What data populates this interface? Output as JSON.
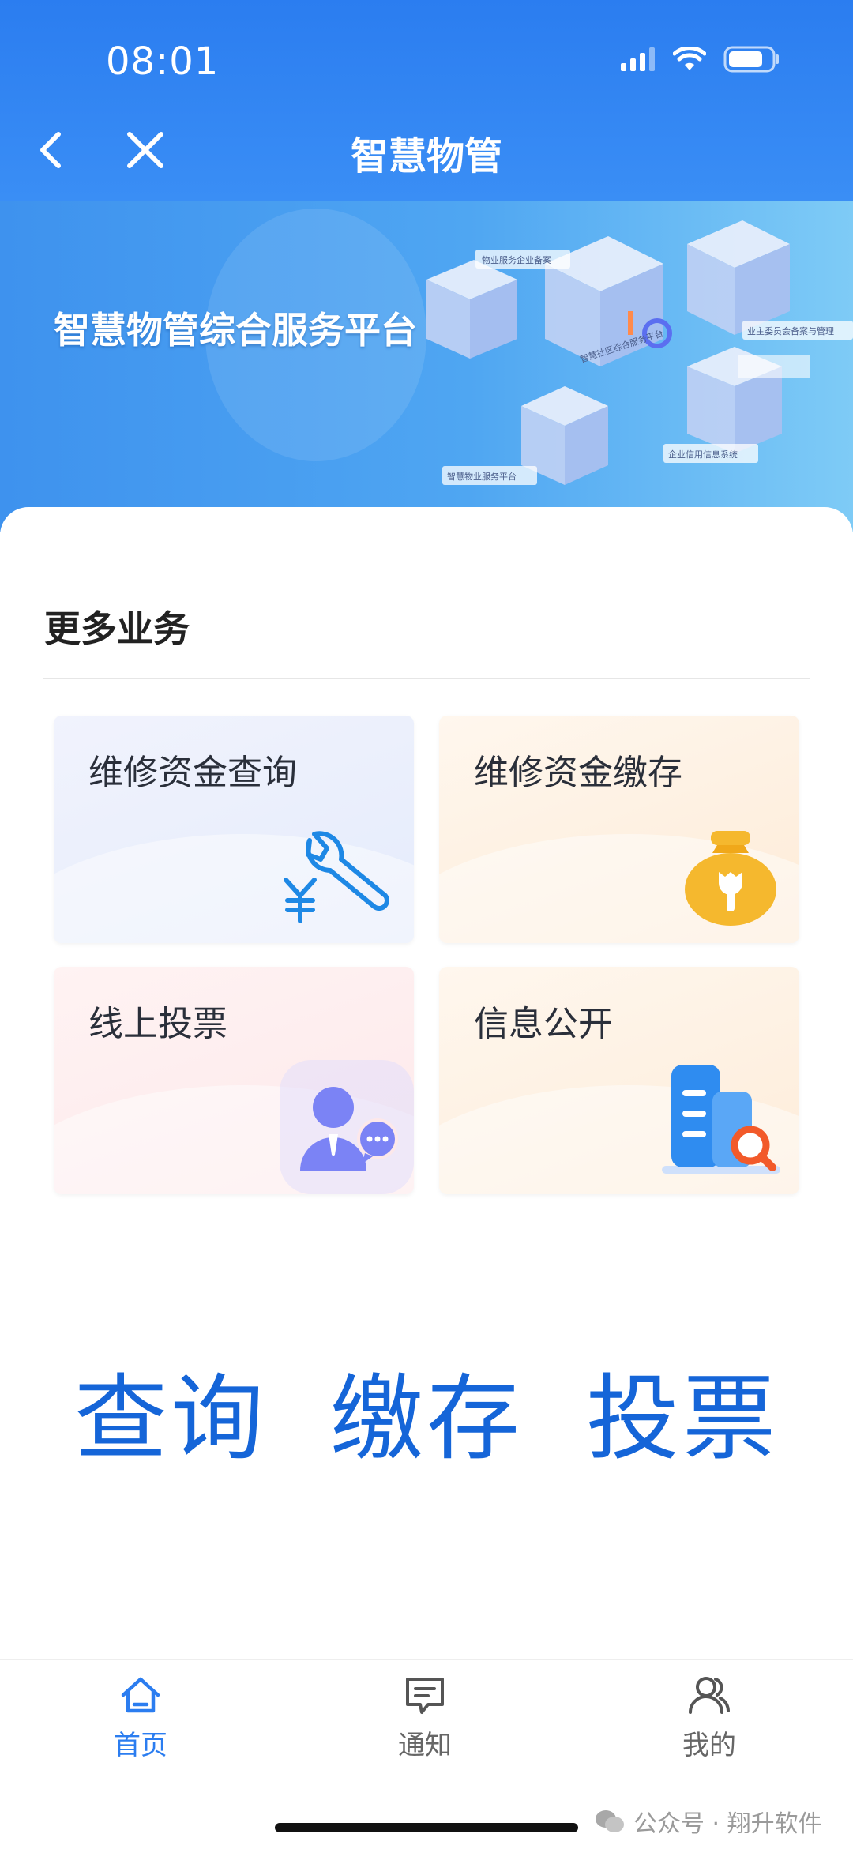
{
  "status_bar": {
    "time": "08:01"
  },
  "nav": {
    "title": "智慧物管"
  },
  "banner": {
    "title": "智慧物管综合服务平台",
    "art_labels": [
      "物业服务企业备案",
      "业主委员会备案与管理",
      "智慧社区综合服务平台",
      "企业信用信息系统",
      "智慧物业服务平台"
    ]
  },
  "section": {
    "title": "更多业务"
  },
  "cards": [
    {
      "label": "维修资金查询",
      "icon": "wrench-yen-icon"
    },
    {
      "label": "维修资金缴存",
      "icon": "money-bag-icon"
    },
    {
      "label": "线上投票",
      "icon": "person-chat-icon"
    },
    {
      "label": "信息公开",
      "icon": "building-search-icon"
    }
  ],
  "highlights": [
    "查询",
    "缴存",
    "投票"
  ],
  "tabbar": {
    "items": [
      {
        "label": "首页",
        "icon": "home-icon",
        "active": true
      },
      {
        "label": "通知",
        "icon": "message-icon",
        "active": false
      },
      {
        "label": "我的",
        "icon": "profile-icon",
        "active": false
      }
    ]
  },
  "watermark": "公众号 · 翔升软件",
  "colors": {
    "primary": "#2b7df0",
    "highlight_text": "#1565d8",
    "bag_yellow": "#f5b82e",
    "vote_purple": "#7b83f5",
    "search_orange": "#f25a2a"
  }
}
